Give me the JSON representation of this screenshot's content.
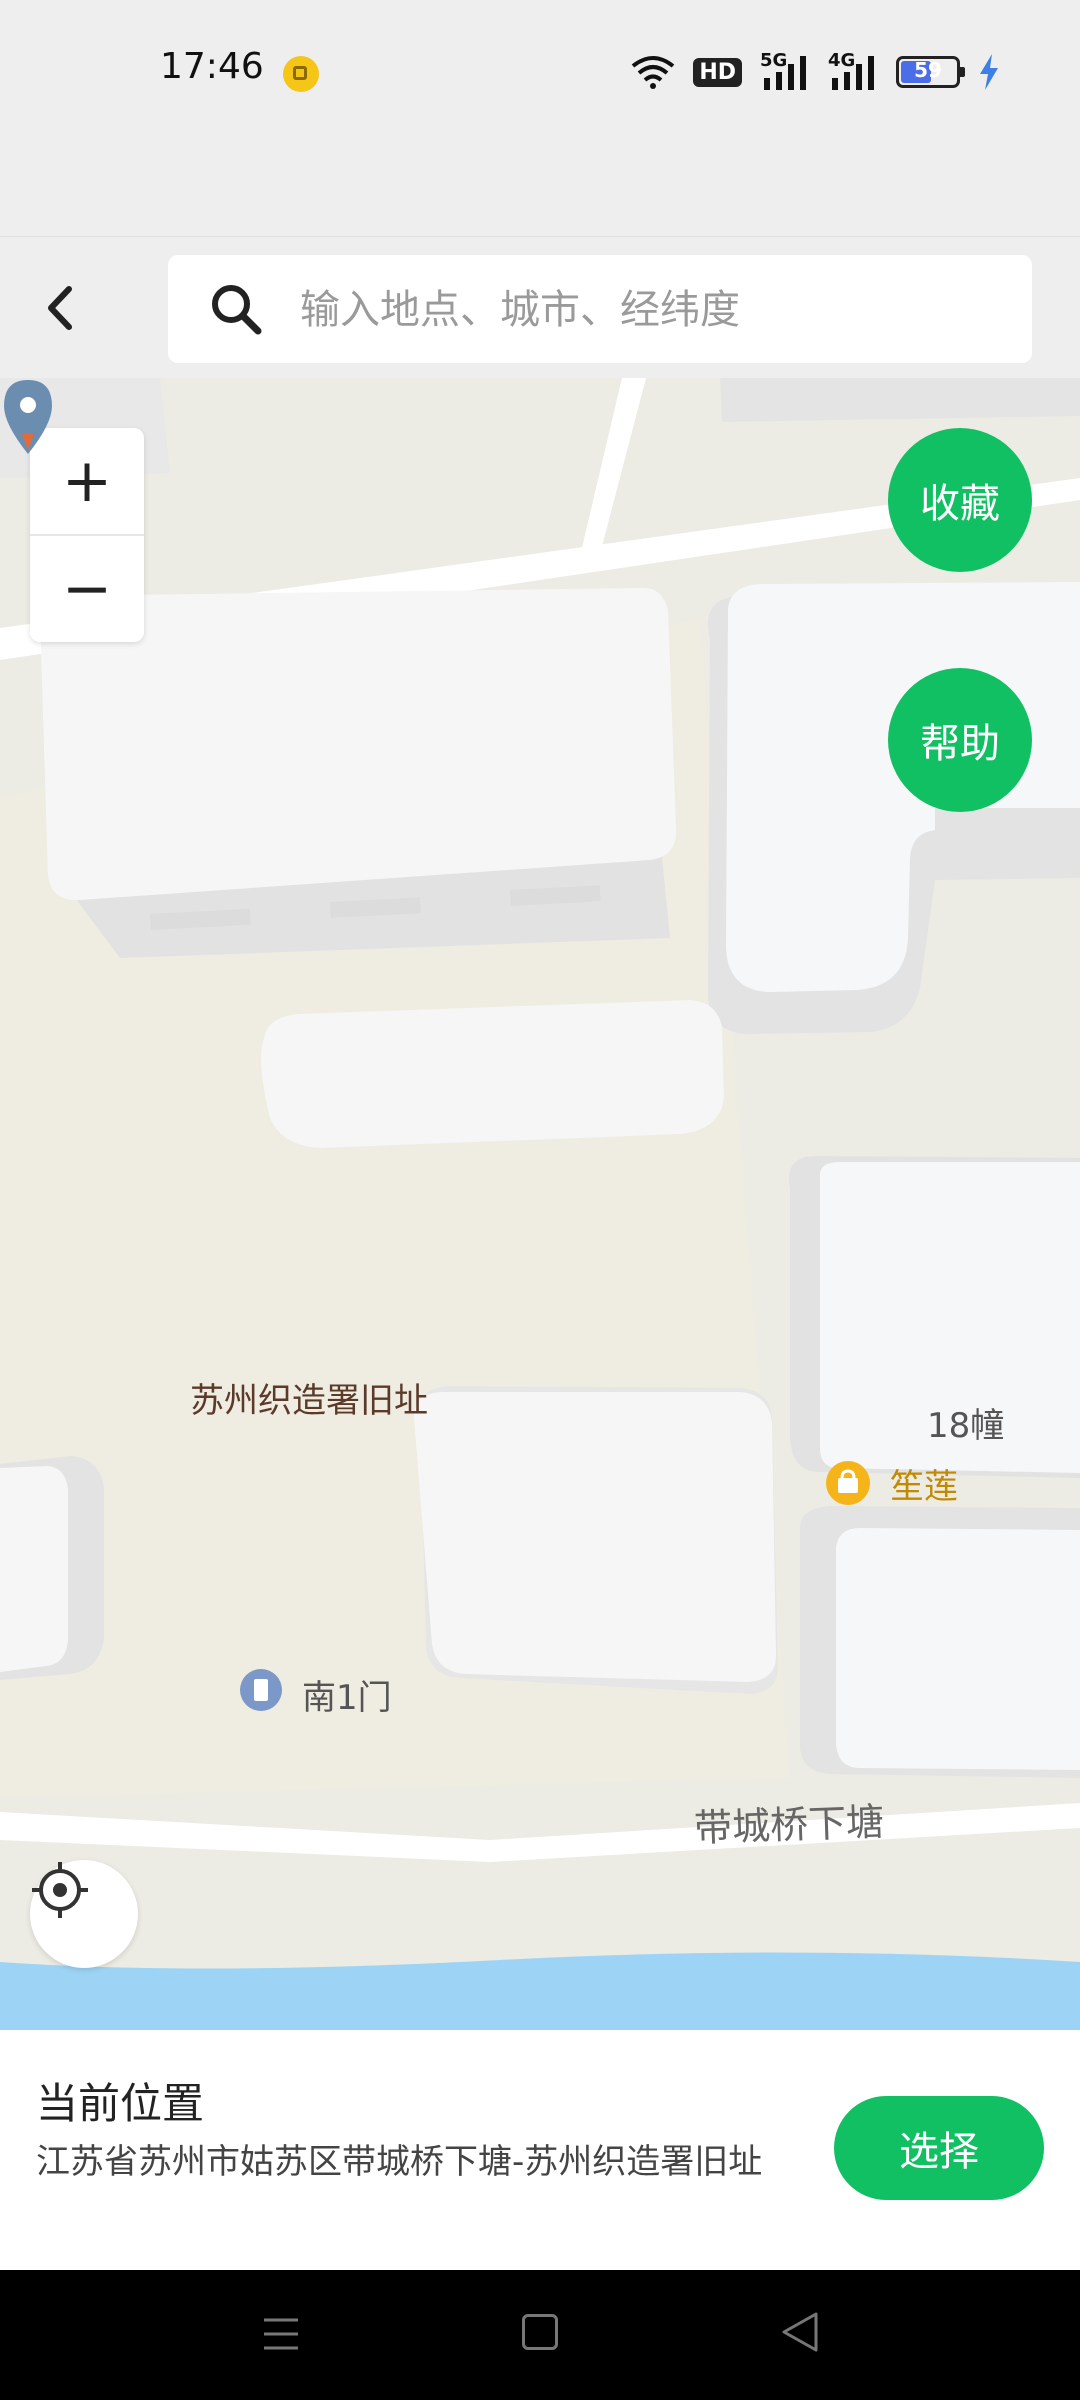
{
  "status_bar": {
    "time": "17:46",
    "hd_label": "HD",
    "signal_5g": "5G",
    "signal_4g": "4G",
    "battery_level": 59,
    "battery_text": "59",
    "charging": true
  },
  "top_bar": {
    "search_placeholder": "输入地点、城市、经纬度"
  },
  "map": {
    "zoom_in_label": "+",
    "zoom_out_label": "−",
    "fab_favorite": "收藏",
    "fab_help": "帮助",
    "labels": {
      "main_poi": "苏州织造署旧址",
      "building_18": "18幢",
      "shop": "笙莲",
      "gate": "南1门",
      "road": "带城桥下塘"
    }
  },
  "bottom_panel": {
    "title": "当前位置",
    "address": "江苏省苏州市姑苏区带城桥下塘-苏州织造署旧址",
    "select_label": "选择"
  },
  "colors": {
    "accent": "#12c064",
    "water": "#9dd4f5",
    "map_bg": "#ecebe4",
    "building": "#f7f7f7"
  }
}
